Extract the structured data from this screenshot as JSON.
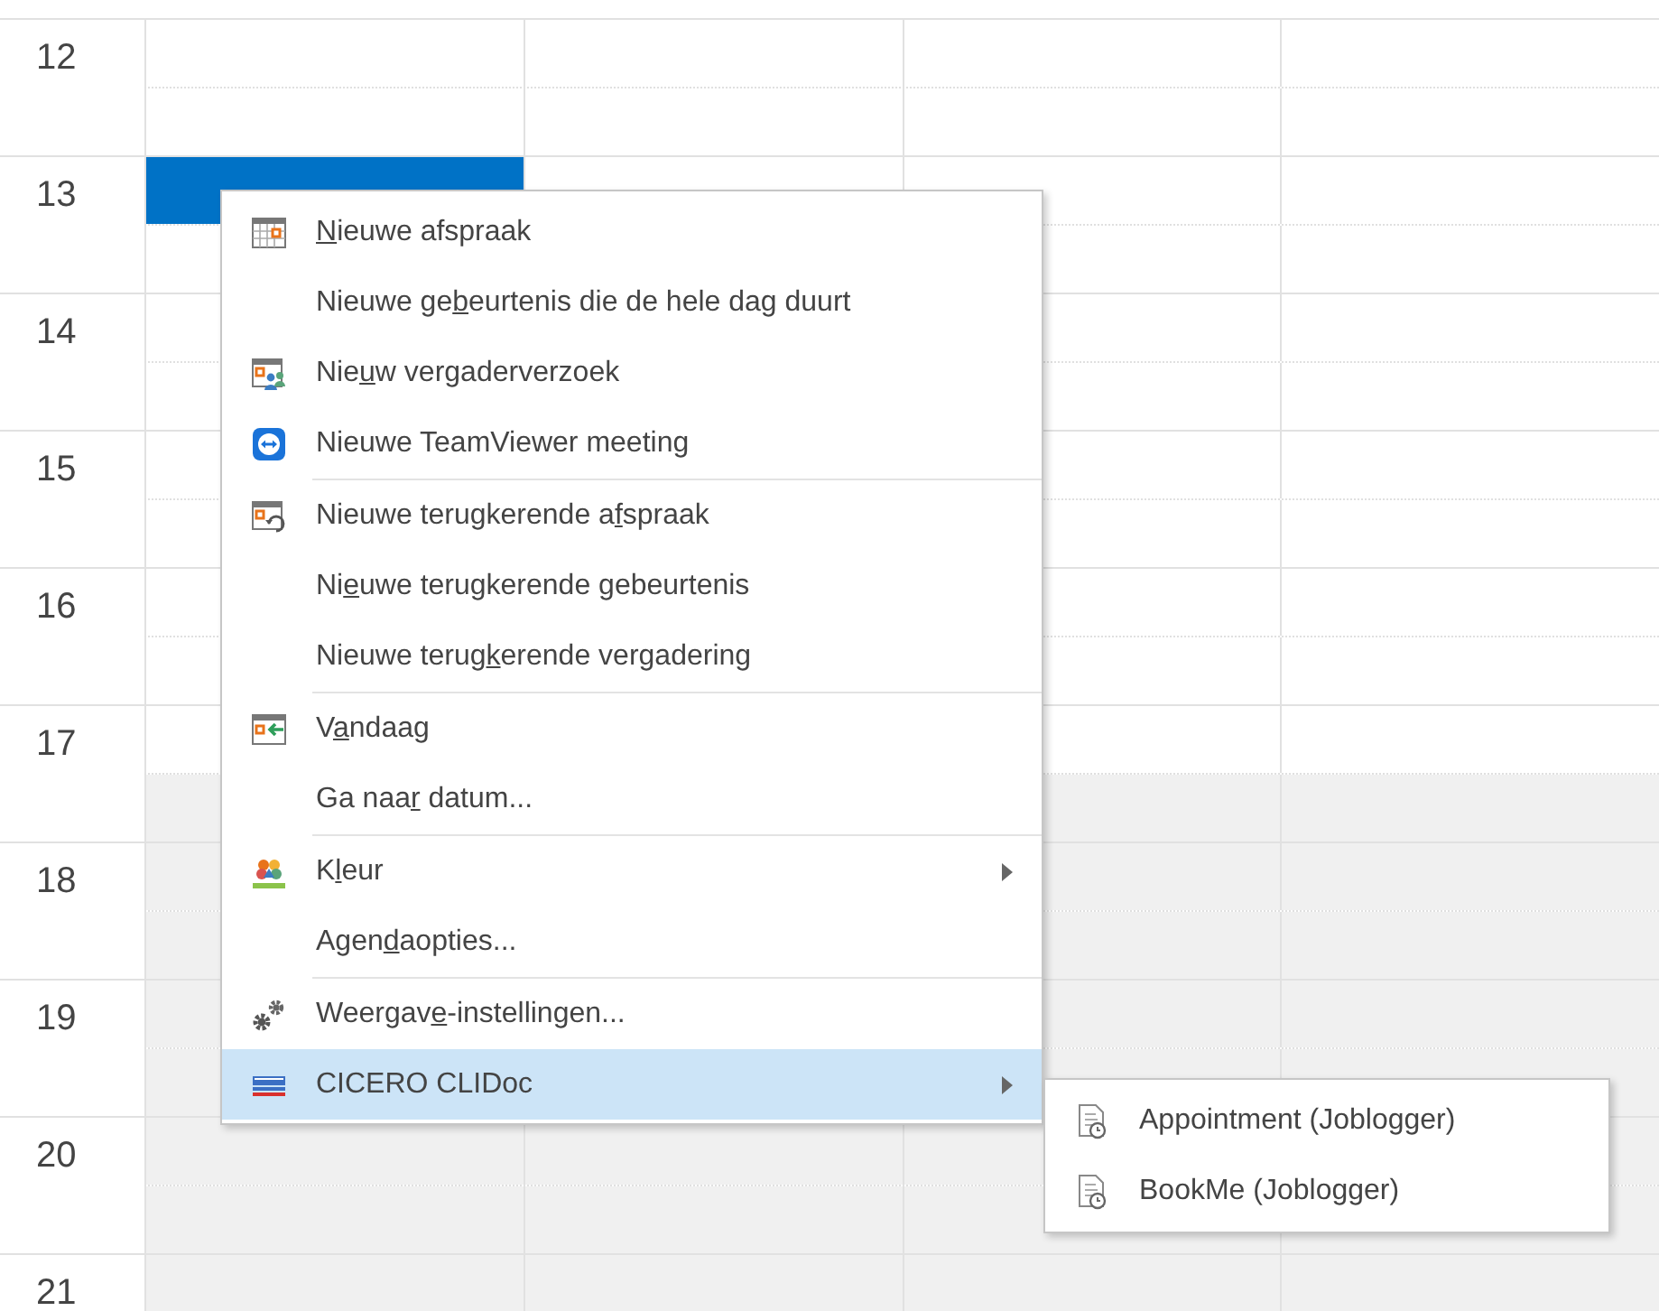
{
  "calendar": {
    "hours": [
      {
        "label": "12",
        "halves": [
          {
            "working": true,
            "first_day_selected": false
          },
          {
            "working": true,
            "first_day_selected": false
          }
        ]
      },
      {
        "label": "13",
        "halves": [
          {
            "working": true,
            "first_day_selected": true
          },
          {
            "working": true,
            "first_day_selected": false
          }
        ]
      },
      {
        "label": "14",
        "halves": [
          {
            "working": true,
            "first_day_selected": false
          },
          {
            "working": true,
            "first_day_selected": false
          }
        ]
      },
      {
        "label": "15",
        "halves": [
          {
            "working": true,
            "first_day_selected": false
          },
          {
            "working": true,
            "first_day_selected": false
          }
        ]
      },
      {
        "label": "16",
        "halves": [
          {
            "working": true,
            "first_day_selected": false
          },
          {
            "working": true,
            "first_day_selected": false
          }
        ]
      },
      {
        "label": "17",
        "halves": [
          {
            "working": true,
            "first_day_selected": false
          },
          {
            "working": false,
            "first_day_selected": false
          }
        ]
      },
      {
        "label": "18",
        "halves": [
          {
            "working": false,
            "first_day_selected": false
          },
          {
            "working": false,
            "first_day_selected": false
          }
        ]
      },
      {
        "label": "19",
        "halves": [
          {
            "working": false,
            "first_day_selected": false
          },
          {
            "working": false,
            "first_day_selected": false
          }
        ]
      },
      {
        "label": "20",
        "halves": [
          {
            "working": false,
            "first_day_selected": false
          },
          {
            "working": false,
            "first_day_selected": false
          }
        ]
      },
      {
        "label": "21",
        "halves": [
          {
            "working": false,
            "first_day_selected": false
          }
        ]
      }
    ]
  },
  "context_menu": {
    "groups": [
      [
        {
          "label_key": "N",
          "label_post": "ieuwe afspraak",
          "selected": false,
          "has_submenu": false
        },
        {
          "label_pre": "Nieuwe ge",
          "label_key": "b",
          "label_post": "eurtenis die de hele dag duurt",
          "selected": false,
          "has_submenu": false
        },
        {
          "label_pre": "Nie",
          "label_key": "u",
          "label_post": "w vergaderverzoek",
          "selected": false,
          "has_submenu": false
        },
        {
          "text": "Nieuwe TeamViewer meeting",
          "selected": false,
          "has_submenu": false
        }
      ],
      [
        {
          "label_pre": "Nieuwe terugkerende a",
          "label_key": "f",
          "label_post": "spraak",
          "selected": false,
          "has_submenu": false
        },
        {
          "label_pre": "Ni",
          "label_key": "e",
          "label_post": "uwe terugkerende gebeurtenis",
          "selected": false,
          "has_submenu": false
        },
        {
          "label_pre": "Nieuwe terug",
          "label_key": "k",
          "label_post": "erende vergadering",
          "selected": false,
          "has_submenu": false
        }
      ],
      [
        {
          "label_pre": "V",
          "label_key": "a",
          "label_post": "ndaag",
          "selected": false,
          "has_submenu": false
        },
        {
          "label_pre": "Ga naa",
          "label_key": "r",
          "label_post": " datum...",
          "selected": false,
          "has_submenu": false
        }
      ],
      [
        {
          "label_pre": "K",
          "label_key": "l",
          "label_post": "eur",
          "selected": false,
          "has_submenu": true
        },
        {
          "label_pre": "Agen",
          "label_key": "d",
          "label_post": "aopties...",
          "selected": false,
          "has_submenu": false
        }
      ],
      [
        {
          "label_pre": "Weergav",
          "label_key": "e",
          "label_post": "-instellingen...",
          "selected": false,
          "has_submenu": false
        },
        {
          "text": "CICERO CLIDoc",
          "selected": true,
          "has_submenu": true
        }
      ]
    ]
  },
  "submenu": {
    "items": [
      {
        "text": "Appointment (Joblogger)"
      },
      {
        "text": "BookMe (Joblogger)"
      }
    ]
  }
}
